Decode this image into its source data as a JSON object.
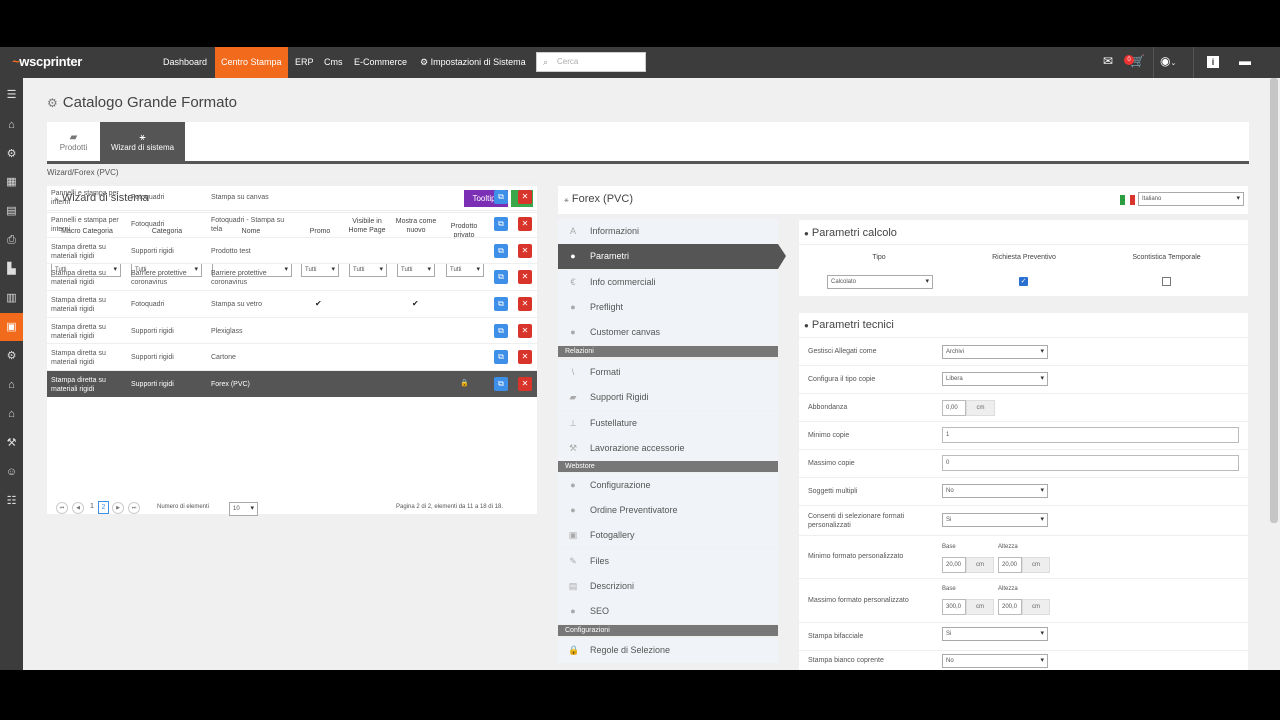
{
  "topbar": {
    "logo": "wscprinter",
    "nav": [
      "Dashboard",
      "Centro Stampa",
      "ERP",
      "Cms",
      "E-Commerce",
      "Impostazioni di Sistema"
    ],
    "search_placeholder": "Cerca",
    "cart_badge": "0"
  },
  "page": {
    "title": "Catalogo Grande Formato",
    "tabs": [
      "Prodotti",
      "Wizard di sistema"
    ],
    "breadcrumb": "Wizard/Forex (PVC)"
  },
  "left": {
    "title": "Wizard di sistema",
    "tooltips_label": "Tooltips",
    "add_label": "+",
    "columns": [
      "Macro Categoria",
      "Categoria",
      "Nome",
      "Promo",
      "Visibile in Home Page",
      "Mostra come nuovo",
      "Prodotto privato"
    ],
    "filters": {
      "macro": "Tutti",
      "categoria": "Tutti",
      "promo": "Tutti",
      "home": "Tutti",
      "nuovo": "Tutti",
      "privato": "Tutti"
    },
    "rows": [
      {
        "macro": "Pannelli e stampa per interni",
        "categoria": "Fotoquadri",
        "nome": "Stampa su canvas",
        "promo": false,
        "nuovo": false,
        "privato": false
      },
      {
        "macro": "Pannelli e stampa per interni",
        "categoria": "Fotoquadri",
        "nome": "Fotoquadri - Stampa su tela",
        "promo": false,
        "nuovo": false,
        "privato": false
      },
      {
        "macro": "Stampa diretta su materiali rigidi",
        "categoria": "Supporti rigidi",
        "nome": "Prodotto test",
        "promo": false,
        "nuovo": false,
        "privato": false
      },
      {
        "macro": "Stampa diretta su materiali rigidi",
        "categoria": "Barriere protettive coronavirus",
        "nome": "Barriere protettive coronavirus",
        "promo": false,
        "nuovo": false,
        "privato": false
      },
      {
        "macro": "Stampa diretta su materiali rigidi",
        "categoria": "Fotoquadri",
        "nome": "Stampa su vetro",
        "promo": true,
        "nuovo": true,
        "privato": false
      },
      {
        "macro": "Stampa diretta su materiali rigidi",
        "categoria": "Supporti rigidi",
        "nome": "Plexiglass",
        "promo": false,
        "nuovo": false,
        "privato": false
      },
      {
        "macro": "Stampa diretta su materiali rigidi",
        "categoria": "Supporti rigidi",
        "nome": "Cartone",
        "promo": false,
        "nuovo": false,
        "privato": false
      },
      {
        "macro": "Stampa diretta su materiali rigidi",
        "categoria": "Supporti rigidi",
        "nome": "Forex (PVC)",
        "promo": false,
        "nuovo": false,
        "privato": true
      }
    ],
    "pager": {
      "pages": [
        "1",
        "2"
      ],
      "current": "2",
      "per_page_label": "Numero di elementi",
      "per_page": "10",
      "info": "Pagina 2 di 2, elementi da 11 a 18 di 18."
    }
  },
  "right": {
    "title": "Forex (PVC)",
    "language": "Italiano",
    "menu": [
      "Informazioni",
      "Parametri",
      "Info commerciali",
      "Preflight",
      "Customer canvas"
    ],
    "sec_relazioni": "Relazioni",
    "menu_rel": [
      "Formati",
      "Supporti Rigidi",
      "Fustellature",
      "Lavorazione accessorie"
    ],
    "sec_webstore": "Webstore",
    "menu_web": [
      "Configurazione",
      "Ordine Preventivatore",
      "Fotogallery",
      "Files",
      "Descrizioni",
      "SEO"
    ],
    "sec_config": "Configurazioni",
    "menu_conf": [
      "Regole di Selezione"
    ]
  },
  "calc": {
    "title": "Parametri calcolo",
    "columns": [
      "Tipo",
      "Richiesta Preventivo",
      "Scontistica Temporale"
    ],
    "tipo": "Calcolato",
    "richiesta": true,
    "scontistica": false
  },
  "tech": {
    "title": "Parametri tecnici",
    "gestisci_label": "Gestisci Allegati come",
    "gestisci_val": "Archivi",
    "tipo_copie_label": "Configura il tipo copie",
    "tipo_copie_val": "Libera",
    "abbondanza_label": "Abbondanza",
    "abbondanza_val": "0,00",
    "unit": "cm",
    "min_copie_label": "Minimo copie",
    "min_copie_val": "1",
    "max_copie_label": "Massimo copie",
    "max_copie_val": "0",
    "soggetti_label": "Soggetti multipli",
    "soggetti_val": "No",
    "consenti_label": "Consenti di selezionare formati personalizzati",
    "consenti_val": "Si",
    "min_formato_label": "Minimo formato personalizzato",
    "max_formato_label": "Massimo formato personalizzato",
    "base_label": "Base",
    "altezza_label": "Altezza",
    "min_base": "20,00",
    "min_alt": "20,00",
    "max_base": "300,0",
    "max_alt": "200,0",
    "bifacciale_label": "Stampa bifacciale",
    "bifacciale_val": "Si",
    "bianco_label": "Stampa bianco coprente",
    "bianco_val": "No"
  }
}
